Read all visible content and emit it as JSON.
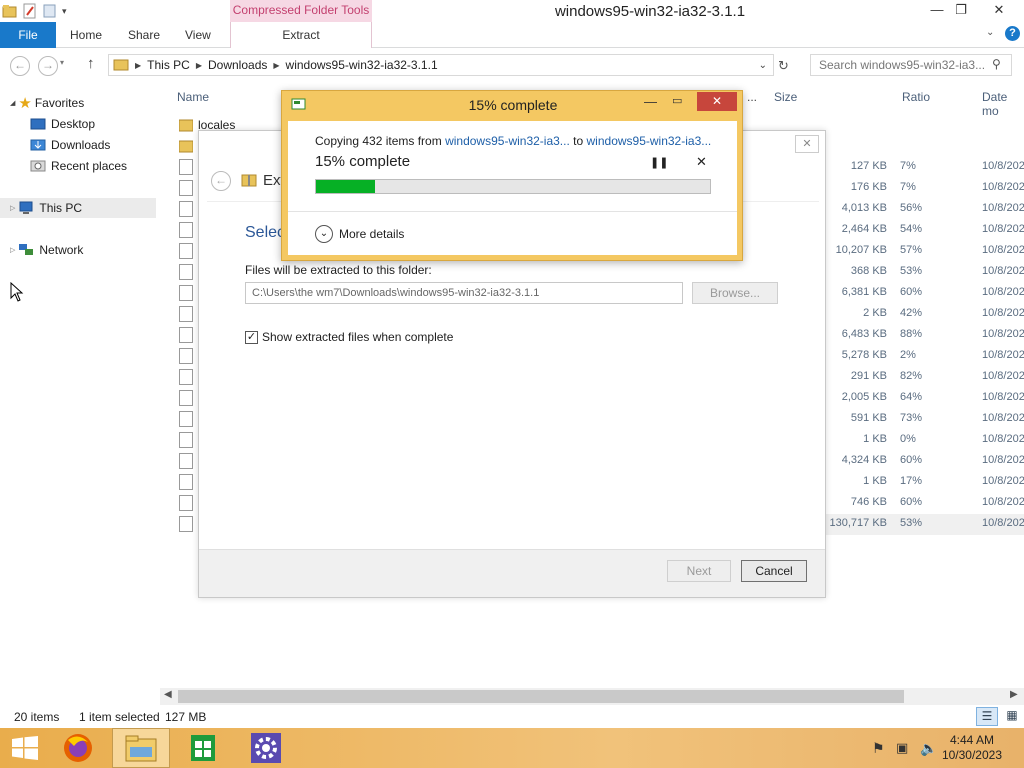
{
  "window": {
    "title": "windows95-win32-ia32-3.1.1",
    "context_tab": "Compressed Folder Tools"
  },
  "ribbon": {
    "file": "File",
    "tabs": [
      "Home",
      "Share",
      "View"
    ],
    "extract": "Extract"
  },
  "address": {
    "crumbs": [
      "This PC",
      "Downloads",
      "windows95-win32-ia32-3.1.1"
    ],
    "search_placeholder": "Search windows95-win32-ia3..."
  },
  "nav": {
    "favorites": "Favorites",
    "desktop": "Desktop",
    "downloads": "Downloads",
    "recent": "Recent places",
    "thispc": "This PC",
    "network": "Network"
  },
  "columns": {
    "name": "Name",
    "size": "Size",
    "ratio": "Ratio",
    "date": "Date mo",
    "ellipsis": "..."
  },
  "files": {
    "first_folder": "locales",
    "rows": [
      {
        "size": "127 KB",
        "ratio": "7%",
        "date": "10/8/202"
      },
      {
        "size": "176 KB",
        "ratio": "7%",
        "date": "10/8/202"
      },
      {
        "size": "4,013 KB",
        "ratio": "56%",
        "date": "10/8/202"
      },
      {
        "size": "2,464 KB",
        "ratio": "54%",
        "date": "10/8/202"
      },
      {
        "size": "10,207 KB",
        "ratio": "57%",
        "date": "10/8/202"
      },
      {
        "size": "368 KB",
        "ratio": "53%",
        "date": "10/8/202"
      },
      {
        "size": "6,381 KB",
        "ratio": "60%",
        "date": "10/8/202"
      },
      {
        "size": "2 KB",
        "ratio": "42%",
        "date": "10/8/202"
      },
      {
        "size": "6,483 KB",
        "ratio": "88%",
        "date": "10/8/202"
      },
      {
        "size": "5,278 KB",
        "ratio": "2%",
        "date": "10/8/202"
      },
      {
        "size": "291 KB",
        "ratio": "82%",
        "date": "10/8/202"
      },
      {
        "size": "2,005 KB",
        "ratio": "64%",
        "date": "10/8/202"
      },
      {
        "size": "591 KB",
        "ratio": "73%",
        "date": "10/8/202"
      },
      {
        "size": "1 KB",
        "ratio": "0%",
        "date": "10/8/202"
      },
      {
        "size": "4,324 KB",
        "ratio": "60%",
        "date": "10/8/202"
      },
      {
        "size": "1 KB",
        "ratio": "17%",
        "date": "10/8/202"
      },
      {
        "size": "746 KB",
        "ratio": "60%",
        "date": "10/8/202"
      },
      {
        "size": "130,717 KB",
        "ratio": "53%",
        "date": "10/8/202"
      }
    ]
  },
  "wizard": {
    "title_partial": "Ext",
    "heading_partial": "Selec",
    "dest_label": "Files will be extracted to this folder:",
    "dest_value": "C:\\Users\\the wm7\\Downloads\\windows95-win32-ia32-3.1.1",
    "browse": "Browse...",
    "show_files": "Show extracted files when complete",
    "next": "Next",
    "cancel": "Cancel"
  },
  "progress": {
    "title": "15% complete",
    "copying_prefix": "Copying 432 items from",
    "source": "windows95-win32-ia3...",
    "to": "to",
    "dest": "windows95-win32-ia3...",
    "percent_text": "15% complete",
    "percent": 15,
    "more_details": "More details"
  },
  "status": {
    "items": "20 items",
    "selected": "1 item selected",
    "size": "127 MB"
  },
  "clock": {
    "time": "4:44 AM",
    "date": "10/30/2023"
  },
  "colors": {
    "accent": "#1979ca",
    "progress_fill": "#06b025",
    "dialog_frame": "#f4c862",
    "taskbar": "#e9ad4c"
  }
}
